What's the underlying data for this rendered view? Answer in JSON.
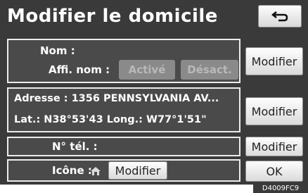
{
  "header": {
    "title": "Modifier le domicile"
  },
  "nom": {
    "label": "Nom :",
    "affi_label": "Affi. nom :",
    "active_label": "Activé",
    "deact_label": "Désact.",
    "modifier_label": "Modifier"
  },
  "adresse": {
    "address_text": "Adresse : 1356 PENNSYLVANIA AV...",
    "latlong_text": "Lat.: N38°53'43    Long.: W77°1'51\"",
    "modifier_label": "Modifier"
  },
  "tel": {
    "label": "N° tél. :",
    "modifier_label": "Modifier"
  },
  "icone": {
    "label": "Icône :",
    "icon_name": "home-marker-icon",
    "modifier_label": "Modifier"
  },
  "ok_label": "OK",
  "figure_code": "D4009FC9"
}
